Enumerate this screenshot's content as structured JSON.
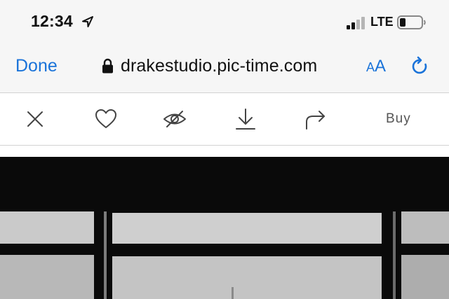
{
  "status_bar": {
    "time": "12:34",
    "carrier": "LTE",
    "icons": [
      "location-arrow-icon",
      "signal-bars-icon",
      "battery-icon"
    ]
  },
  "address_bar": {
    "done_label": "Done",
    "url": "drakestudio.pic-time.com",
    "text_size_small": "A",
    "text_size_large": "A",
    "icons": [
      "lock-icon",
      "reload-icon"
    ]
  },
  "toolbar": {
    "buy_label": "Buy",
    "icons": [
      "close-icon",
      "heart-icon",
      "hide-eye-icon",
      "download-icon",
      "share-arrow-icon"
    ]
  },
  "colors": {
    "accent": "#1a73d9",
    "bar_background": "#f6f6f6",
    "toolbar_background": "#ffffff",
    "icon_gray": "#444444"
  }
}
